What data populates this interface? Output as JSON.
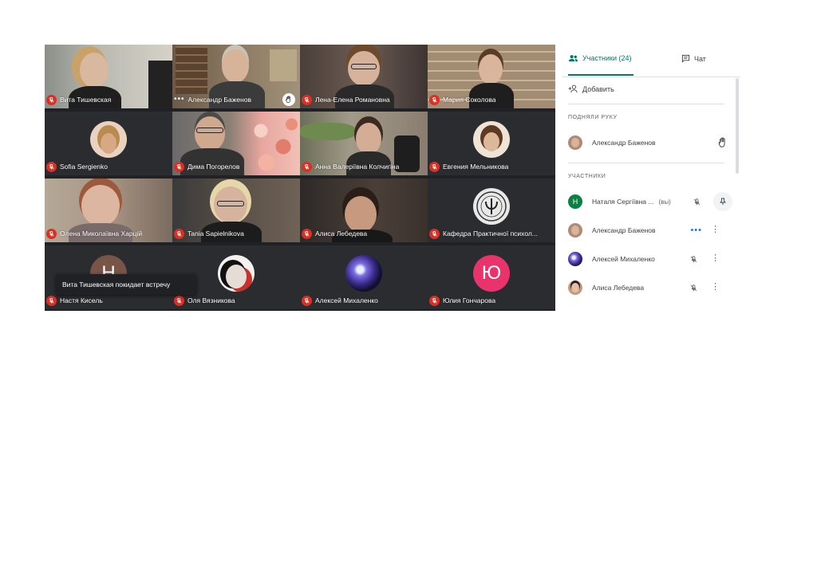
{
  "toast": "Вита Тишевская покидает встречу",
  "tiles": [
    {
      "name": "Вита Тишевская",
      "mic": "muted"
    },
    {
      "name": "Александр Баженов",
      "mic": "more",
      "hand": true
    },
    {
      "name": "Лена-Елена Романовна",
      "mic": "muted"
    },
    {
      "name": "Мария Соколова",
      "mic": "muted"
    },
    {
      "name": "Sofia Sergienko",
      "mic": "muted"
    },
    {
      "name": "Дима Погорелов",
      "mic": "muted"
    },
    {
      "name": "Анна Валеріївна Колчигіна",
      "mic": "muted"
    },
    {
      "name": "Евгения Мельникова",
      "mic": "muted"
    },
    {
      "name": "Олена Миколаївна Харцій",
      "mic": "muted"
    },
    {
      "name": "Tania Sapielnikova",
      "mic": "muted"
    },
    {
      "name": "Алиса Лебедева",
      "mic": "muted"
    },
    {
      "name": "Кафедра Практичної психол...",
      "mic": "muted"
    },
    {
      "name": "Настя Кисель",
      "mic": "muted",
      "initial": "Н"
    },
    {
      "name": "Оля Вязникова",
      "mic": "muted"
    },
    {
      "name": "Алексей Михаленко",
      "mic": "muted"
    },
    {
      "name": "Юлия Гончарова",
      "mic": "muted",
      "initial": "Ю"
    }
  ],
  "panel": {
    "tab_people": "Участники (24)",
    "tab_chat": "Чат",
    "add_label": "Добавить",
    "raised_hands_header": "ПОДНЯЛИ РУКУ",
    "raised_hands": [
      {
        "name": "Александр Баженов"
      }
    ],
    "participants_header": "УЧАСТНИКИ",
    "participants": [
      {
        "name": "Наталя Сергіївна ...",
        "suffix": "(вы)",
        "initial": "Н"
      },
      {
        "name": "Александр Баженов"
      },
      {
        "name": "Алексей Михаленко"
      },
      {
        "name": "Алиса Лебедева"
      }
    ]
  },
  "colors": {
    "accent": "#00796b",
    "mute_red": "#d93025",
    "grid_bg": "#202124",
    "julia_avatar": "#e8336d"
  }
}
